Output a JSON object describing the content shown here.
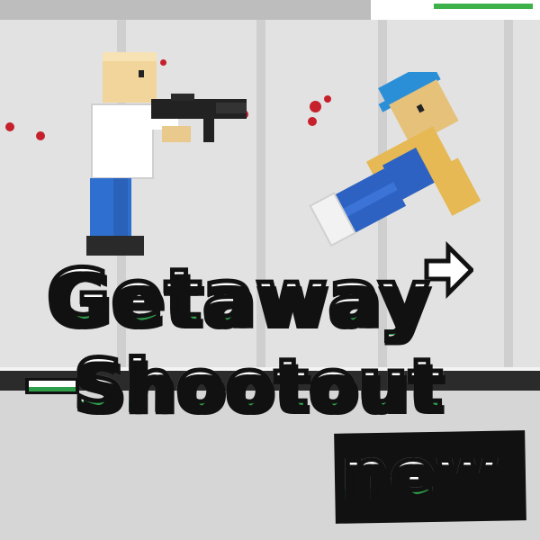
{
  "game": {
    "title_line1": "Getaway",
    "title_line2": "Shootout",
    "title_badge": "new"
  },
  "colors": {
    "title_fill": "#ffffff",
    "title_outline": "#111111",
    "title_accent": "#2e9e4a",
    "blood": "#c5202b",
    "wall": "#e2e2e2",
    "rail": "#2b2b2b"
  },
  "icons": {
    "arrow": "arrow-right-icon"
  }
}
